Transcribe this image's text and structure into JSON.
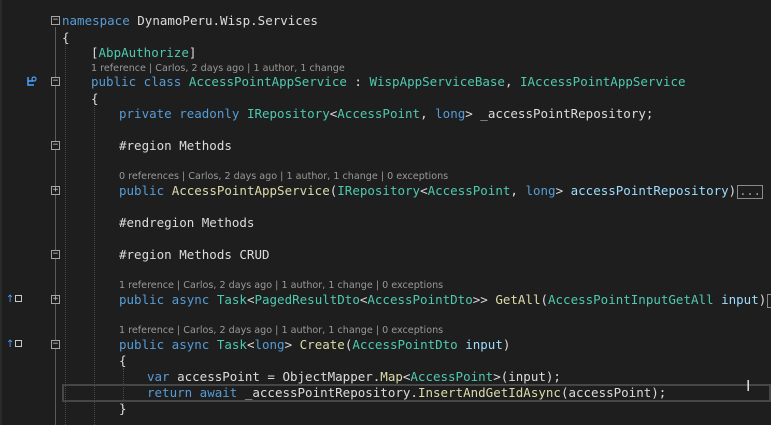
{
  "editor": {
    "namespace_keyword": "namespace",
    "namespace_name": "DynamoPeru.Wisp.Services",
    "open_brace": "{",
    "close_brace": "}",
    "attribute_open": "[",
    "attribute_name": "AbpAuthorize",
    "attribute_close": "]",
    "class_lens": "1 reference | Carlos, 2 days ago | 1 author, 1 change",
    "class_keywords": "public class",
    "class_name": "AccessPointAppService",
    "class_colon": " : ",
    "base_class": "WispAppServiceBase",
    "comma": ", ",
    "interface_name": "IAccessPointAppService",
    "field_keywords": "private readonly",
    "field_type": "IRepository",
    "lt": "<",
    "gt": ">",
    "entity_name": "AccessPoint",
    "long_kw": "long",
    "field_name": " _accessPointRepository;",
    "region_methods": "#region Methods",
    "ctor_lens": "0 references | Carlos, 2 days ago | 1 author, 1 change | 0 exceptions",
    "public_kw": "public",
    "ctor_name": "AccessPointAppService",
    "open_paren": "(",
    "close_paren": ")",
    "ctor_param": " accessPointRepository",
    "collapsed_text": "...",
    "endregion_methods": "#endregion Methods",
    "region_methods_crud": "#region Methods CRUD",
    "getall_lens": "1 reference | Carlos, 2 days ago | 1 author, 1 change | 0 exceptions",
    "async_kw": "public async",
    "task_type": "Task",
    "paged_result_type": "PagedResultDto",
    "dto_type": "AccessPointDto",
    "getall_gt": ">> ",
    "getall_name": "GetAll",
    "getall_param_type": "AccessPointInputGetAll",
    "input_param": " input",
    "create_lens": "1 reference | Carlos, 2 days ago | 1 author, 1 change | 0 exceptions",
    "create_gt": "> ",
    "create_name": "Create",
    "var_kw": "var",
    "local_var": " accessPoint = ObjectMapper.",
    "map_fn": "Map",
    "map_args": "(input);",
    "return_await_kw": "return await",
    "repo_call": " _accessPointRepository.",
    "insert_fn": "InsertAndGetIdAsync",
    "insert_args": "(accessPoint);",
    "fold_minus": "−",
    "fold_plus": "+",
    "gutter_arrow": "↑"
  },
  "colors": {
    "background": "#1e1e1e",
    "keyword": "#569cd6",
    "type": "#4ec9b0",
    "method": "#dcdcaa",
    "parameter": "#9cdcfe",
    "plain": "#dcdcdc",
    "codelens": "#999999",
    "gutter_icon": "#4aa3ff"
  }
}
